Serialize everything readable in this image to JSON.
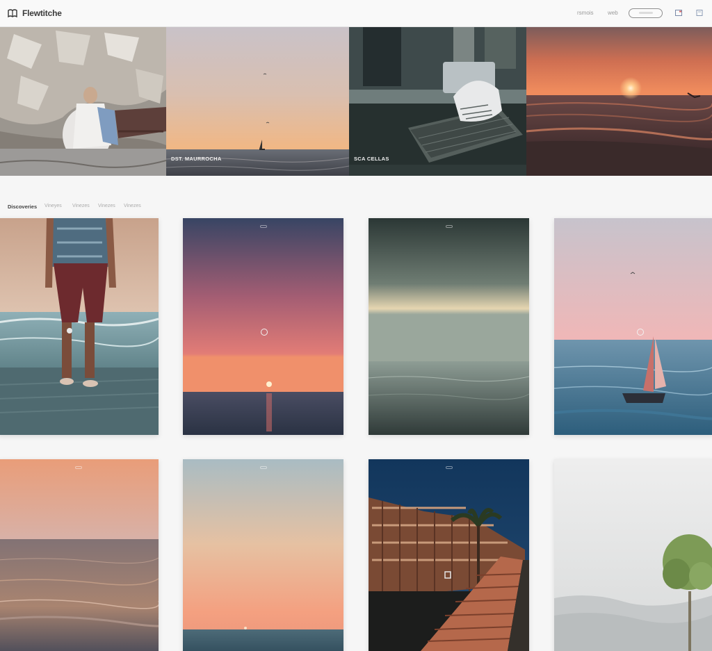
{
  "app": {
    "title": "Flewtitche",
    "logo_icon": "book-icon"
  },
  "nav": {
    "links": [
      "rsmois",
      "web"
    ],
    "search_placeholder": "",
    "icons": [
      "grid-icon",
      "bookmark-icon"
    ]
  },
  "hero": {
    "tiles": [
      {
        "caption": "",
        "sub": "",
        "scene": "rocky-shore"
      },
      {
        "caption": "DST. MAURROCHA",
        "sub": "",
        "scene": "calm-sea-sailboat"
      },
      {
        "caption": "SCA CELLAS",
        "sub": "",
        "scene": "boat-interior"
      },
      {
        "caption": "",
        "sub": "",
        "scene": "red-sunset-sea"
      }
    ]
  },
  "filters": {
    "items": [
      "Discoveries",
      "Vineyes",
      "Vinezes",
      "Vinezes",
      "Vinezes"
    ]
  },
  "grid": {
    "rows": [
      [
        {
          "tag": "",
          "foot": "",
          "scene": "person-on-beach"
        },
        {
          "tag": "",
          "foot": "",
          "scene": "purple-sunset"
        },
        {
          "tag": "",
          "foot": "",
          "scene": "teal-horizon"
        },
        {
          "tag": "",
          "foot": "",
          "scene": "sailboat-pink-sky"
        }
      ],
      [
        {
          "tag": "",
          "foot": "",
          "scene": "peach-ocean"
        },
        {
          "tag": "",
          "foot": "",
          "scene": "pastel-dusk"
        },
        {
          "tag": "",
          "foot": "",
          "scene": "palm-boardwalk"
        },
        {
          "tag": "",
          "foot": "",
          "scene": "misty-tree"
        }
      ]
    ]
  },
  "colors": {
    "background": "#f6f6f6",
    "topbar": "#f9f9f9",
    "text_primary": "#3a3a3a",
    "text_muted": "#9a9a9a"
  }
}
